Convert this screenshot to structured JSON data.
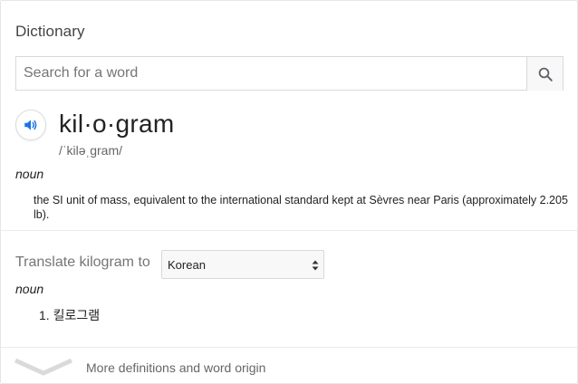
{
  "dictionary": {
    "title": "Dictionary",
    "search": {
      "placeholder": "Search for a word",
      "value": ""
    },
    "entry": {
      "word": "kil·o·gram",
      "pronunciation": "/ˈkiləˌgram/",
      "part_of_speech": "noun",
      "definition": "the SI unit of mass, equivalent to the international standard kept at Sèvres near Paris (approximately 2.205 lb)."
    },
    "translate": {
      "label": "Translate kilogram to",
      "selected_language": "Korean",
      "part_of_speech": "noun",
      "results": [
        "1. 킬로그램"
      ]
    },
    "footer": {
      "more_label": "More definitions and word origin"
    }
  },
  "colors": {
    "accent_blue": "#1a73e8",
    "muted_text": "#757575",
    "border": "#d9d9d9"
  },
  "icons": {
    "search_button": "search-icon",
    "pronunciation": "speaker-icon",
    "select": "updown-arrows-icon",
    "expand": "chevron-down-icon"
  }
}
